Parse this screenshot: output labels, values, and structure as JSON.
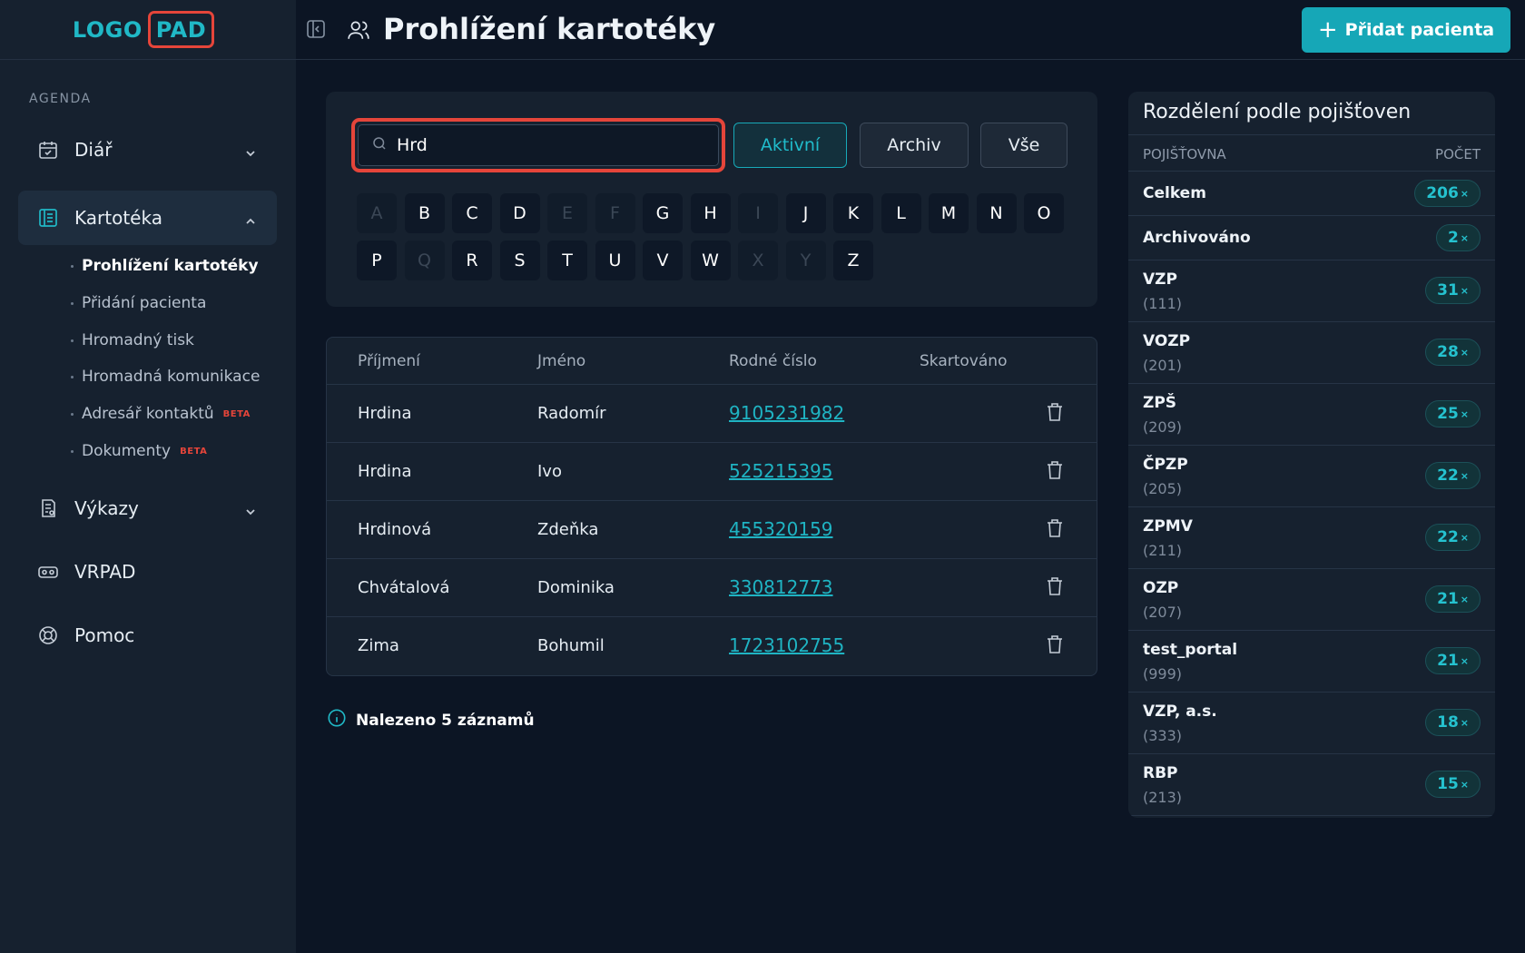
{
  "logo": {
    "text": "LOGO",
    "box": "PAD"
  },
  "sidebar": {
    "section": "AGENDA",
    "items": [
      {
        "label": "Diář",
        "icon": "calendar-icon"
      },
      {
        "label": "Kartotéka",
        "icon": "files-icon"
      },
      {
        "label": "Výkazy",
        "icon": "report-icon"
      },
      {
        "label": "VRPAD",
        "icon": "vr-headset-icon"
      },
      {
        "label": "Pomoc",
        "icon": "help-lifebuoy-icon"
      }
    ],
    "subitems": [
      "Prohlížení kartotéky",
      "Přidání pacienta",
      "Hromadný tisk",
      "Hromadná komunikace",
      "Adresář kontaktů",
      "Dokumenty"
    ],
    "beta_label": "BETA"
  },
  "header": {
    "title": "Prohlížení kartotéky",
    "add_button": "Přidat pacienta"
  },
  "search": {
    "value": "Hrd"
  },
  "filters": {
    "active": "Aktivní",
    "archive": "Archiv",
    "all": "Vše"
  },
  "letters": {
    "row1": [
      "A",
      "B",
      "C",
      "D",
      "E",
      "F",
      "G",
      "H",
      "I",
      "J",
      "K",
      "L",
      "M",
      "N",
      "O"
    ],
    "row2": [
      "P",
      "Q",
      "R",
      "S",
      "T",
      "U",
      "V",
      "W",
      "X",
      "Y",
      "Z"
    ],
    "disabled": [
      "A",
      "E",
      "F",
      "I",
      "Q",
      "X",
      "Y"
    ]
  },
  "table": {
    "headers": [
      "Příjmení",
      "Jméno",
      "Rodné číslo",
      "Skartováno"
    ],
    "rows": [
      {
        "surname": "Hrdina",
        "name": "Radomír",
        "rc": "9105231982"
      },
      {
        "surname": "Hrdina",
        "name": "Ivo",
        "rc": "525215395"
      },
      {
        "surname": "Hrdinová",
        "name": "Zdeňka",
        "rc": "455320159"
      },
      {
        "surname": "Chvátalová",
        "name": "Dominika",
        "rc": "330812773"
      },
      {
        "surname": "Zima",
        "name": "Bohumil",
        "rc": "1723102755"
      }
    ]
  },
  "result_text": "Nalezeno 5 záznamů",
  "insurers": {
    "title": "Rozdělení podle pojišťoven",
    "col_name": "POJIŠŤOVNA",
    "col_count": "POČET",
    "count_suffix": "×",
    "rows": [
      {
        "name": "Celkem",
        "code": "",
        "count": "206"
      },
      {
        "name": "Archivováno",
        "code": "",
        "count": "2"
      },
      {
        "name": "VZP",
        "code": "(111)",
        "count": "31"
      },
      {
        "name": "VOZP",
        "code": "(201)",
        "count": "28"
      },
      {
        "name": "ZPŠ",
        "code": "(209)",
        "count": "25"
      },
      {
        "name": "ČPZP",
        "code": "(205)",
        "count": "22"
      },
      {
        "name": "ZPMV",
        "code": "(211)",
        "count": "22"
      },
      {
        "name": "OZP",
        "code": "(207)",
        "count": "21"
      },
      {
        "name": "test_portal",
        "code": "(999)",
        "count": "21"
      },
      {
        "name": "VZP, a.s.",
        "code": "(333)",
        "count": "18"
      },
      {
        "name": "RBP",
        "code": "(213)",
        "count": "15"
      }
    ]
  },
  "colors": {
    "accent": "#16a7b7",
    "highlight": "#e5453a",
    "background": "#0c1524",
    "panel": "#16212f"
  }
}
